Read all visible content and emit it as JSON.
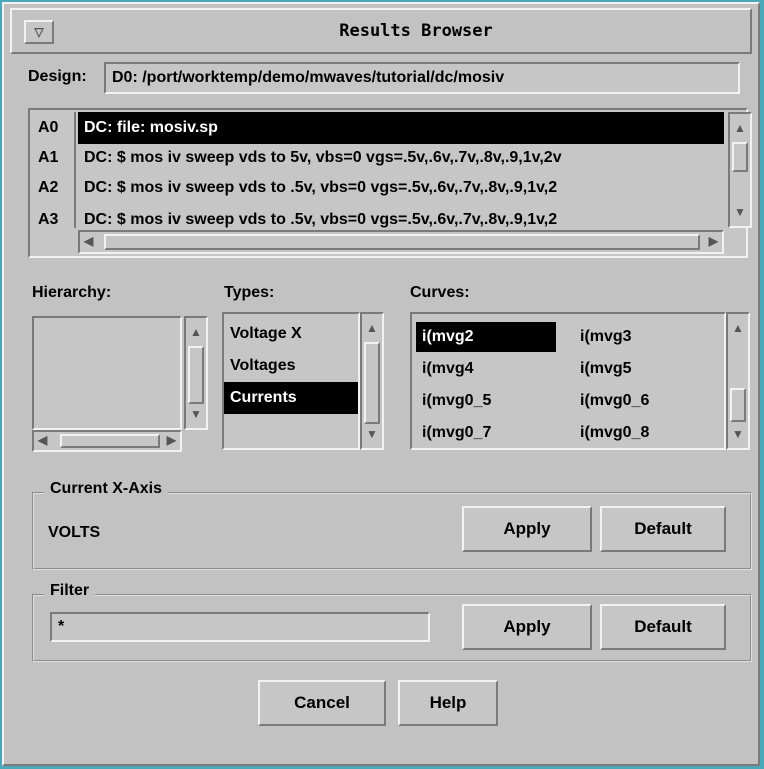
{
  "window": {
    "title": "Results Browser",
    "menu_icon": "window-menu-icon"
  },
  "design": {
    "label": "Design:",
    "value": "D0: /port/worktemp/demo/mwaves/tutorial/dc/mosiv"
  },
  "results": {
    "items": [
      {
        "id": "A0",
        "text": "DC: file: mosiv.sp",
        "selected": true
      },
      {
        "id": "A1",
        "text": "DC: $  mos iv sweep vds to 5v, vbs=0 vgs=.5v,.6v,.7v,.8v,.9,1v,2v"
      },
      {
        "id": "A2",
        "text": "DC: $  mos iv sweep vds to .5v, vbs=0 vgs=.5v,.6v,.7v,.8v,.9,1v,2"
      },
      {
        "id": "A3",
        "text": "DC: $  mos iv sweep vds to .5v, vbs=0 vgs=.5v,.6v,.7v,.8v,.9,1v,2"
      }
    ]
  },
  "hierarchy": {
    "label": "Hierarchy:"
  },
  "types": {
    "label": "Types:",
    "items": [
      "Voltage X",
      "Voltages",
      "Currents"
    ],
    "selected": "Currents"
  },
  "curves": {
    "label": "Curves:",
    "items": [
      "i(mvg2",
      "i(mvg3",
      "i(mvg4",
      "i(mvg5",
      "i(mvg0_5",
      "i(mvg0_6",
      "i(mvg0_7",
      "i(mvg0_8"
    ],
    "selected": "i(mvg2"
  },
  "xaxis": {
    "label": "Current X-Axis",
    "value": "VOLTS",
    "apply": "Apply",
    "default": "Default"
  },
  "filter": {
    "label": "Filter",
    "value": "*",
    "apply": "Apply",
    "default": "Default"
  },
  "buttons": {
    "cancel": "Cancel",
    "help": "Help"
  },
  "colors": {
    "background": "#c2c2c2",
    "desktop": "#4aa8b8",
    "selection": "#000000"
  }
}
